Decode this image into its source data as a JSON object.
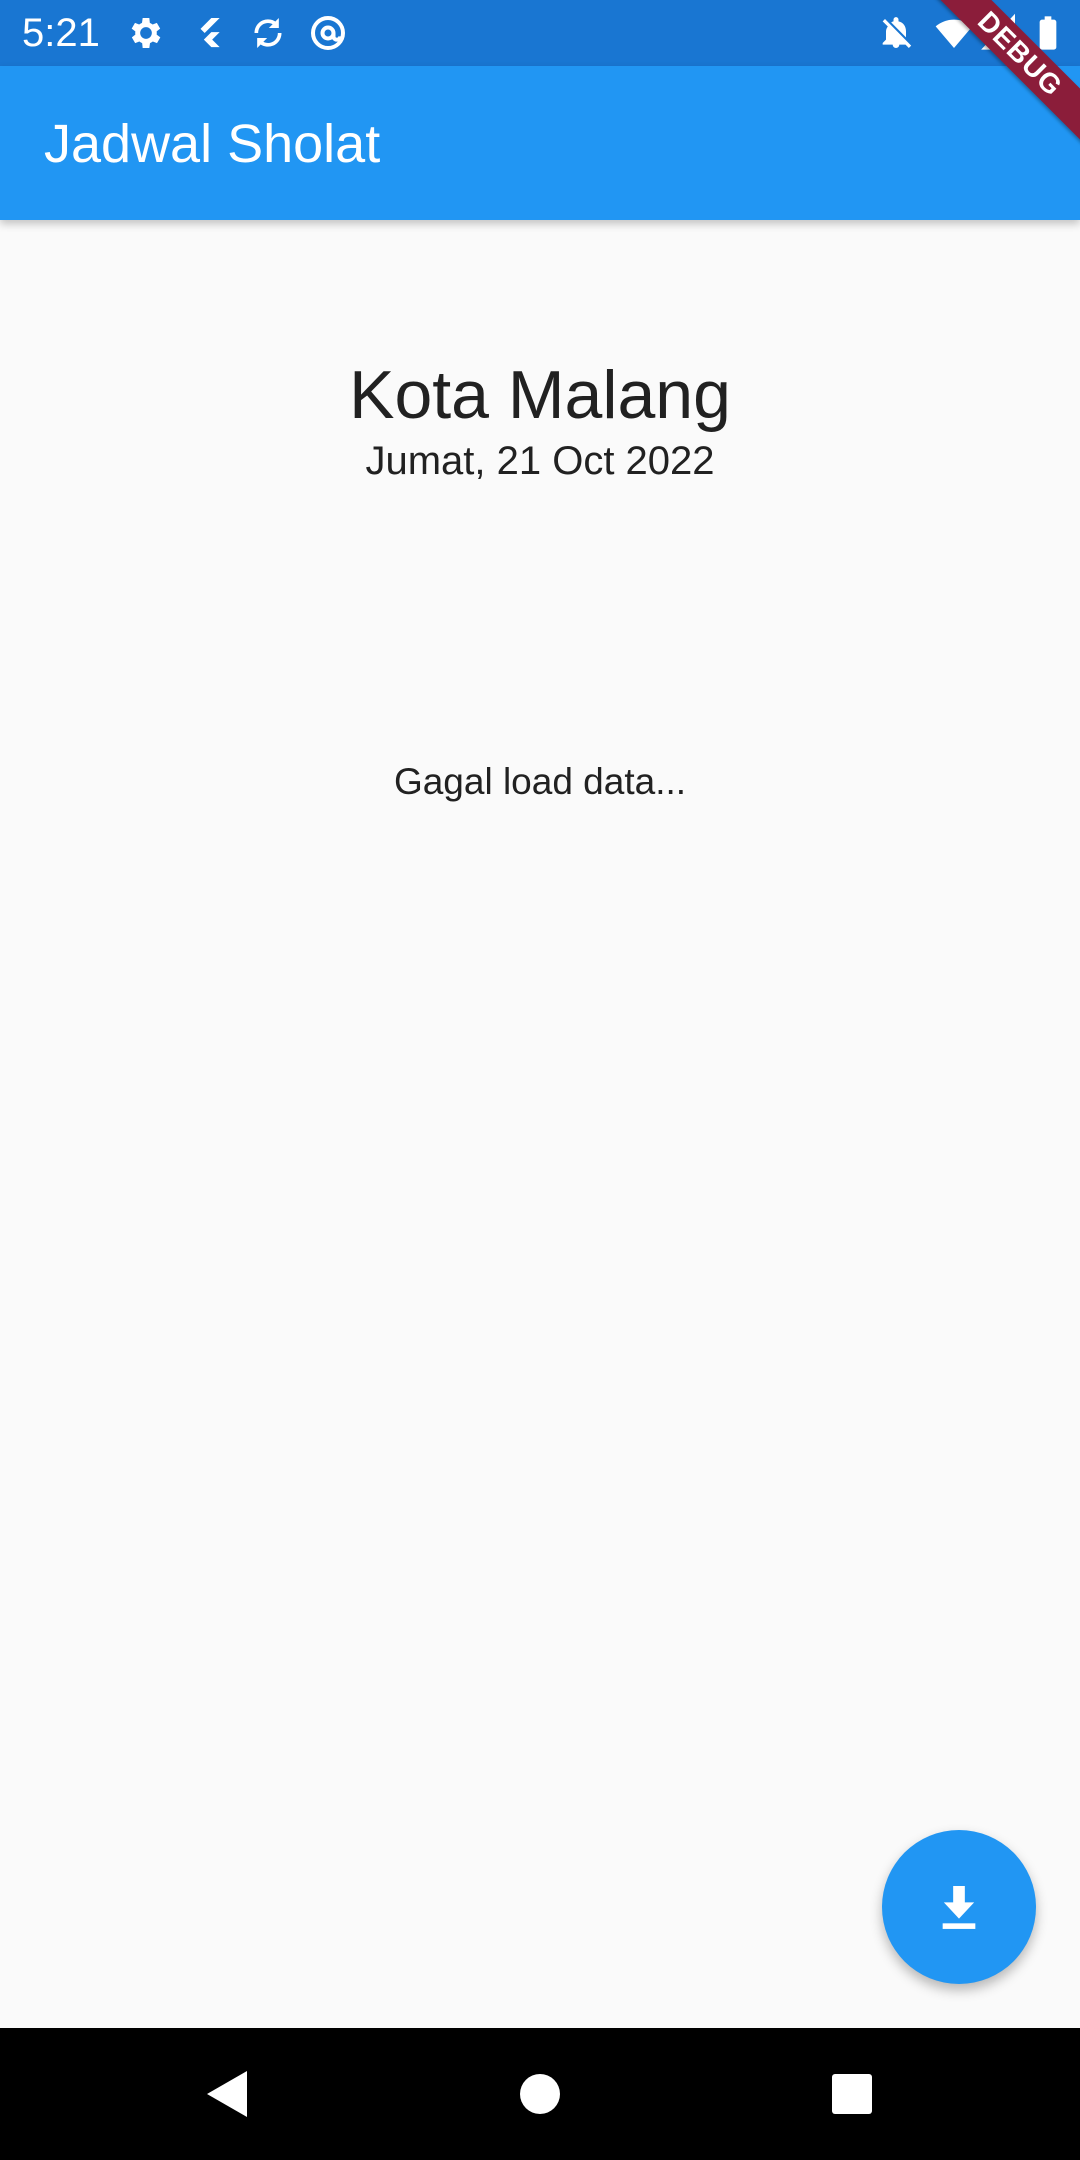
{
  "status_bar": {
    "time": "5:21",
    "icons_left": [
      "gear-icon",
      "flutter-icon",
      "sync-icon",
      "at-sign-icon"
    ],
    "icons_right": [
      "notifications-off-icon",
      "wifi-icon",
      "signal-icon",
      "battery-icon"
    ]
  },
  "debug_banner": {
    "label": "DEBUG",
    "color": "#8b1d3a"
  },
  "app_bar": {
    "title": "Jadwal Sholat",
    "color": "#2196f3"
  },
  "main": {
    "city": "Kota Malang",
    "date": "Jumat, 21 Oct 2022",
    "status_message": "Gagal load data..."
  },
  "fab": {
    "icon": "download-icon",
    "color": "#2196f3"
  },
  "nav_bar": {
    "buttons": [
      "back-icon",
      "home-icon",
      "recents-icon"
    ]
  }
}
